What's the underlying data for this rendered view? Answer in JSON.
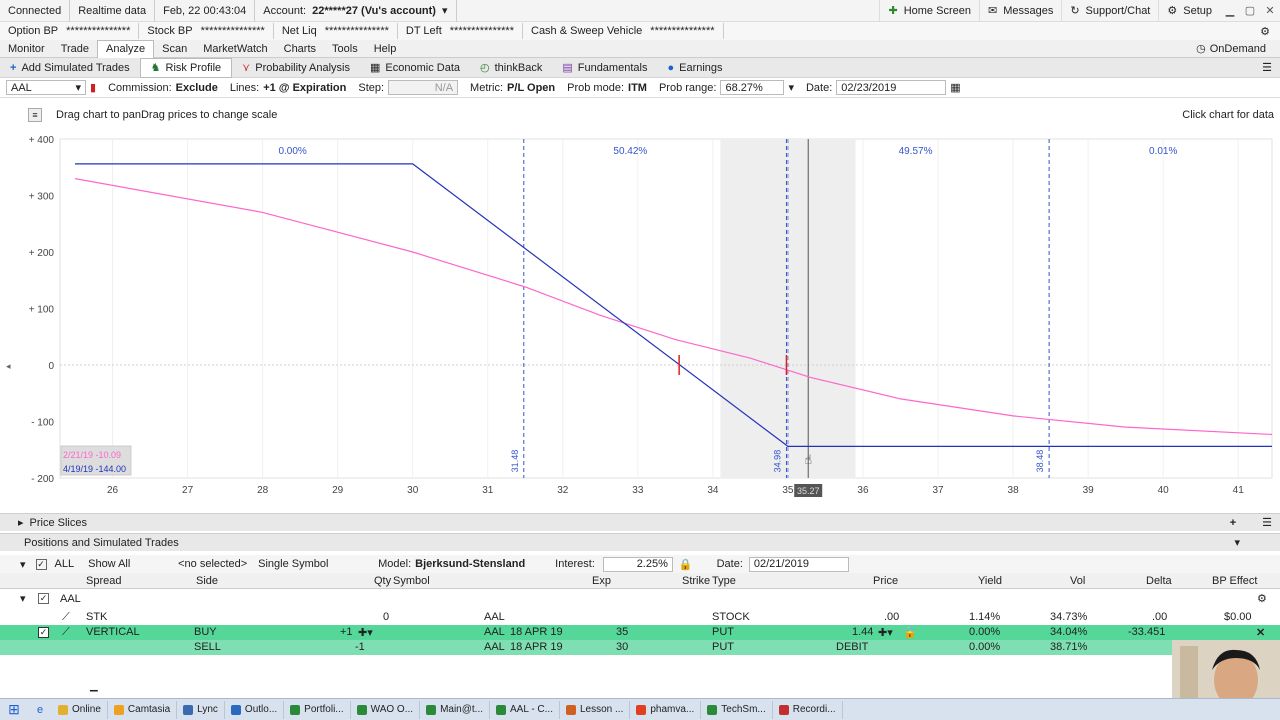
{
  "status": {
    "connected": "Connected",
    "feed": "Realtime data",
    "datetime": "Feb, 22  00:43:04",
    "account_label": "Account:",
    "account_value": "22*****27 (Vu's account)",
    "home": "Home Screen",
    "messages": "Messages",
    "support": "Support/Chat",
    "setup": "Setup"
  },
  "bp": {
    "option_bp": "Option BP",
    "option_bp_val": "***************",
    "stock_bp": "Stock BP",
    "stock_bp_val": "***************",
    "net_liq": "Net Liq",
    "net_liq_val": "***************",
    "dt_left": "DT Left",
    "dt_left_val": "***************",
    "cash": "Cash & Sweep Vehicle",
    "cash_val": "***************"
  },
  "nav": {
    "items": [
      "Monitor",
      "Trade",
      "Analyze",
      "Scan",
      "MarketWatch",
      "Charts",
      "Tools",
      "Help"
    ],
    "ondemand": "OnDemand"
  },
  "toolbar": {
    "items": [
      "Add Simulated Trades",
      "Risk Profile",
      "Probability Analysis",
      "Economic Data",
      "thinkBack",
      "Fundamentals",
      "Earnings"
    ]
  },
  "options": {
    "symbol": "AAL",
    "commission_label": "Commission:",
    "commission_value": "Exclude",
    "lines_label": "Lines:",
    "lines_value": "+1 @ Expiration",
    "step_label": "Step:",
    "step_value": "N/A",
    "metric_label": "Metric:",
    "metric_value": "P/L Open",
    "prob_label": "Prob mode:",
    "prob_value": "ITM",
    "prob_range_label": "Prob range:",
    "prob_range_value": "68.27%",
    "date_label": "Date:",
    "date_value": "02/23/2019"
  },
  "hint": {
    "left": "Drag chart to panDrag prices to change scale",
    "right": "Click chart for data"
  },
  "chart_data": {
    "type": "line",
    "x_ticks": [
      26,
      27,
      28,
      29,
      30,
      31,
      32,
      33,
      34,
      35,
      36,
      37,
      38,
      39,
      40,
      41
    ],
    "y_ticks": [
      400,
      300,
      200,
      100,
      0,
      -100,
      -200
    ],
    "y_tick_labels": [
      "+ 400",
      "+ 300",
      "+ 200",
      "+ 100",
      "0",
      "- 100",
      "- 200"
    ],
    "xlim": [
      25.3,
      41.45
    ],
    "ylim": [
      -200,
      400
    ],
    "series": [
      {
        "name": "2/21/19 -10.09",
        "color": "#ff66cc",
        "points": [
          [
            25.5,
            330
          ],
          [
            28,
            270
          ],
          [
            30,
            200
          ],
          [
            31.5,
            138
          ],
          [
            32.5,
            88
          ],
          [
            33.5,
            45
          ],
          [
            34.5,
            12
          ],
          [
            35.3,
            -22
          ],
          [
            36.5,
            -60
          ],
          [
            38,
            -90
          ],
          [
            39.5,
            -110
          ],
          [
            41.45,
            -123
          ]
        ]
      },
      {
        "name": "4/19/19 -144.00",
        "color": "#2233bb",
        "points": [
          [
            25.5,
            356
          ],
          [
            30,
            356
          ],
          [
            35,
            -144
          ],
          [
            41.45,
            -144
          ]
        ]
      }
    ],
    "sigma_lines": [
      {
        "x": 31.48,
        "label": "31.48"
      },
      {
        "x": 34.98,
        "label": "34.98"
      },
      {
        "x": 38.48,
        "label": "38.48"
      }
    ],
    "prob_labels": [
      {
        "x": 28.4,
        "text": "0.00%"
      },
      {
        "x": 32.9,
        "text": "50.42%"
      },
      {
        "x": 36.7,
        "text": "49.57%"
      },
      {
        "x": 40,
        "text": "0.01%"
      }
    ],
    "strike_line_x": 35,
    "cursor_x": 35.27,
    "cursor_label": "35.27",
    "shade_range": [
      34.1,
      35.9
    ],
    "marker_xs": [
      33.55,
      34.98
    ],
    "legend": [
      "2/21/19 -10.09",
      "4/19/19 -144.00"
    ]
  },
  "panels": {
    "price_slices": "Price Slices",
    "positions": "Positions and Simulated Trades"
  },
  "filters": {
    "all": "ALL",
    "show_all": "Show All",
    "no_selected": "<no selected>",
    "single_symbol": "Single Symbol",
    "model_label": "Model:",
    "model_value": "Bjerksund-Stensland",
    "interest_label": "Interest:",
    "interest_value": "2.25%",
    "date_label": "Date:",
    "date_value": "02/21/2019"
  },
  "columns": {
    "spread": "Spread",
    "side": "Side",
    "qty": "Qty",
    "symbol": "Symbol",
    "exp": "Exp",
    "strike": "Strike",
    "type": "Type",
    "price": "Price",
    "yield": "Yield",
    "vol": "Vol",
    "delta": "Delta",
    "bp": "BP Effect"
  },
  "group": "AAL",
  "rows": {
    "stk": {
      "spread": "STK",
      "qty": "0",
      "symbol": "AAL",
      "type": "STOCK",
      "price": ".00",
      "yield": "1.14%",
      "vol": "34.73%",
      "delta": ".00",
      "bp": "$0.00"
    },
    "leg1": {
      "spread": "VERTICAL",
      "side": "BUY",
      "qty": "+1",
      "symbol": "AAL",
      "exp": "18 APR 19",
      "strike": "35",
      "type": "PUT",
      "price": "1.44",
      "yield": "0.00%",
      "vol": "34.04%",
      "delta": "-33.451"
    },
    "leg2": {
      "side": "SELL",
      "qty": "-1",
      "symbol": "AAL",
      "exp": "18 APR 19",
      "strike": "30",
      "type": "PUT",
      "price": "DEBIT",
      "yield": "0.00%",
      "vol": "38.71%"
    }
  },
  "taskbar": [
    "Online",
    "Camtasia",
    "Lync",
    "Outlo...",
    "Portfoli...",
    "WAO O...",
    "Main@t...",
    "AAL - C...",
    "Lesson ...",
    "phamva...",
    "TechSm...",
    "Recordi..."
  ]
}
